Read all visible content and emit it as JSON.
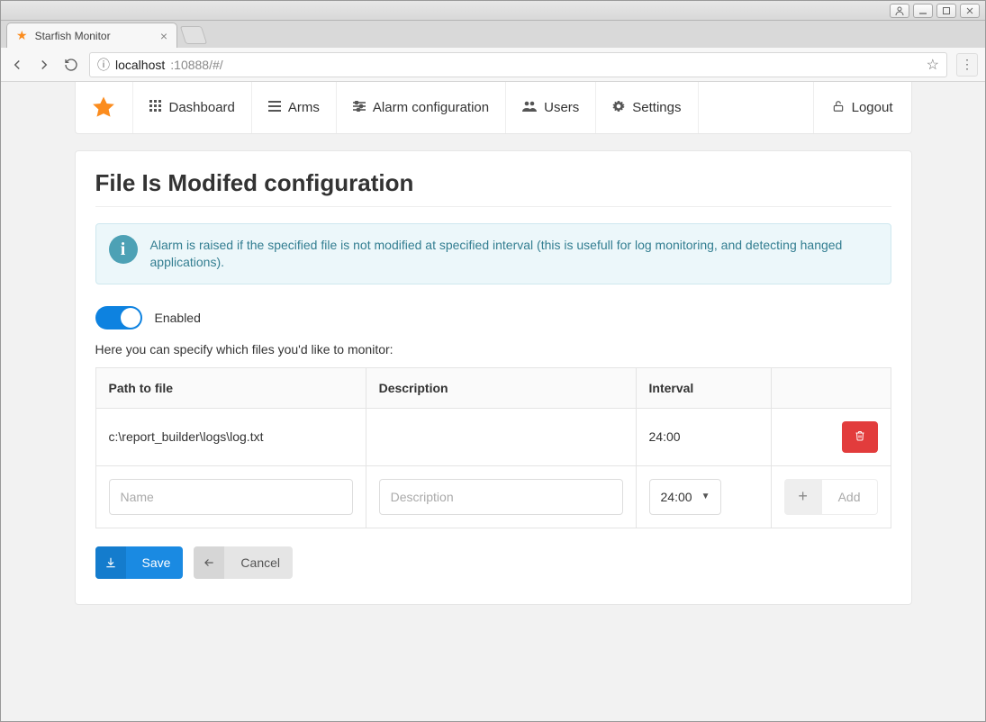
{
  "window": {
    "tab_title": "Starfish Monitor",
    "url_host": "localhost",
    "url_rest": ":10888/#/"
  },
  "nav": {
    "dashboard": "Dashboard",
    "arms": "Arms",
    "alarm_config": "Alarm configuration",
    "users": "Users",
    "settings": "Settings",
    "logout": "Logout"
  },
  "page": {
    "title": "File Is Modifed configuration",
    "info": "Alarm is raised if the specified file is not modified at specified interval (this is usefull for log monitoring, and detecting hanged applications).",
    "enabled_label": "Enabled",
    "enabled": true,
    "subtext": "Here you can specify which files you'd like to monitor:"
  },
  "table": {
    "headers": {
      "path": "Path to file",
      "description": "Description",
      "interval": "Interval"
    },
    "rows": [
      {
        "path": "c:\\report_builder\\logs\\log.txt",
        "description": "",
        "interval": "24:00"
      }
    ],
    "new_row": {
      "name_placeholder": "Name",
      "desc_placeholder": "Description",
      "interval_value": "24:00",
      "add_label": "Add"
    }
  },
  "actions": {
    "save": "Save",
    "cancel": "Cancel"
  }
}
